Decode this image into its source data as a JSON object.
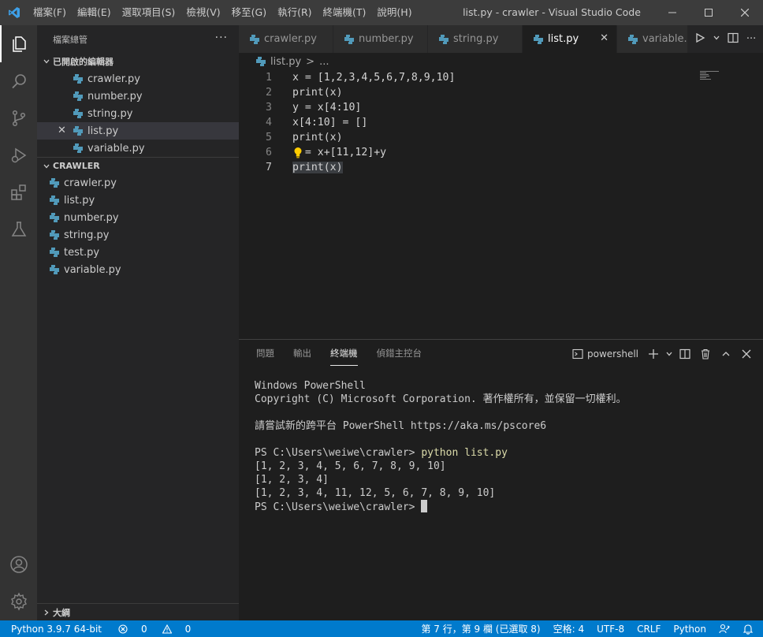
{
  "titlebar": {
    "menu": [
      "檔案(F)",
      "編輯(E)",
      "選取項目(S)",
      "檢視(V)",
      "移至(G)",
      "執行(R)",
      "終端機(T)",
      "說明(H)"
    ],
    "title": "list.py - crawler - Visual Studio Code"
  },
  "sidebar": {
    "header": "檔案總管",
    "more": "···",
    "open_editors_title": "已開啟的編輯器",
    "open_editors": [
      "crawler.py",
      "number.py",
      "string.py",
      "list.py",
      "variable.py"
    ],
    "folder_title": "CRAWLER",
    "files": [
      "crawler.py",
      "list.py",
      "number.py",
      "string.py",
      "test.py",
      "variable.py"
    ],
    "outline_title": "大綱"
  },
  "tabs": [
    "crawler.py",
    "number.py",
    "string.py",
    "list.py",
    "variable."
  ],
  "breadcrumb": {
    "file": "list.py",
    "sep": ">",
    "more": "..."
  },
  "editor": {
    "line_numbers": [
      "1",
      "2",
      "3",
      "4",
      "5",
      "6",
      "7"
    ],
    "lines": [
      "x = [1,2,3,4,5,6,7,8,9,10]",
      "print(x)",
      "y = x[4:10]",
      "x[4:10] = []",
      "print(x)",
      "  = x+[11,12]+y",
      "print(x)"
    ]
  },
  "panel": {
    "tabs": [
      "問題",
      "輸出",
      "終端機",
      "偵錯主控台"
    ],
    "shell": "powershell",
    "terminal": {
      "l1": "Windows PowerShell",
      "l2": "Copyright (C) Microsoft Corporation. 著作權所有，並保留一切權利。",
      "l3": "",
      "l4": "請嘗試新的跨平台 PowerShell https://aka.ms/pscore6",
      "l5": "",
      "prompt": "PS C:\\Users\\weiwe\\crawler> ",
      "command": "python list.py",
      "o1": "[1, 2, 3, 4, 5, 6, 7, 8, 9, 10]",
      "o2": "[1, 2, 3, 4]",
      "o3": "[1, 2, 3, 4, 11, 12, 5, 6, 7, 8, 9, 10]",
      "prompt2": "PS C:\\Users\\weiwe\\crawler> "
    }
  },
  "statusbar": {
    "python": "Python 3.9.7 64-bit",
    "errors": "0",
    "warnings": "0",
    "position": "第 7 行，第 9 欄 (已選取 8)",
    "spaces": "空格: 4",
    "encoding": "UTF-8",
    "eol": "CRLF",
    "language": "Python"
  },
  "colors": {
    "accent": "#007acc",
    "python_icon": "#519aba"
  }
}
